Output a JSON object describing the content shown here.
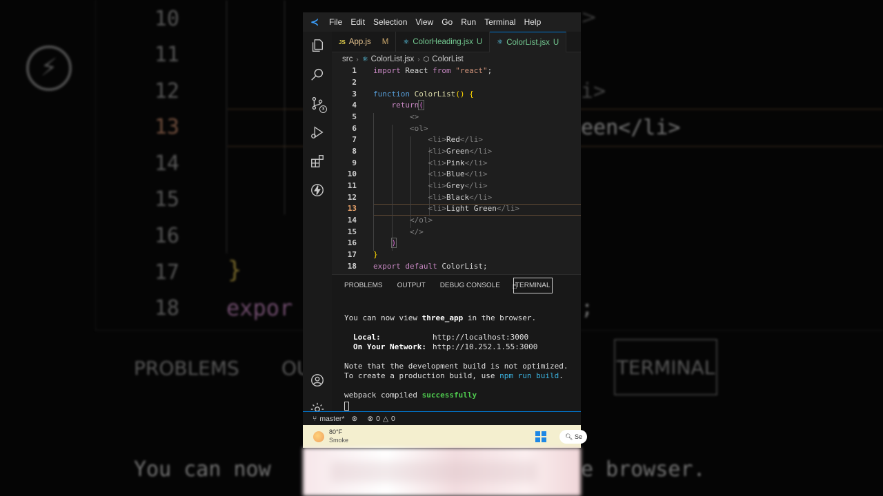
{
  "menubar": {
    "items": [
      "File",
      "Edit",
      "Selection",
      "View",
      "Go",
      "Run",
      "Terminal",
      "Help"
    ]
  },
  "tabs": [
    {
      "icon": "JS",
      "name": "App.js",
      "status": "M"
    },
    {
      "icon": "⚛",
      "name": "ColorHeading.jsx",
      "status": "U"
    },
    {
      "icon": "⚛",
      "name": "ColorList.jsx",
      "status": "U"
    }
  ],
  "breadcrumb": {
    "folder": "src",
    "file": "ColorList.jsx",
    "symbol": "ColorList"
  },
  "editor": {
    "line_numbers": [
      "1",
      "2",
      "3",
      "4",
      "5",
      "6",
      "7",
      "8",
      "9",
      "10",
      "11",
      "12",
      "13",
      "14",
      "15",
      "16",
      "17",
      "18"
    ],
    "current_line": "13",
    "l1": {
      "import": "import",
      "name": "React",
      "from": "from",
      "module": "\"react\"",
      "semi": ";"
    },
    "l3": {
      "function": "function",
      "name": "ColorList",
      "parens": "()",
      "brace": "{"
    },
    "l4": {
      "return": "return",
      "paren": "("
    },
    "l5": "<>",
    "l6": "<ol>",
    "items": [
      "Red",
      "Green",
      "Pink",
      "Blue",
      "Grey",
      "Black",
      "Light Green"
    ],
    "li_open": "<li>",
    "li_close": "</li>",
    "l14": "</ol>",
    "l15": "</>",
    "l16": ")",
    "l17": "}",
    "l18": {
      "export": "export",
      "default": "default",
      "name": "ColorList",
      "semi": ";"
    }
  },
  "panel": {
    "tabs": [
      "PROBLEMS",
      "OUTPUT",
      "DEBUG CONSOLE",
      "TERMINAL"
    ],
    "active_tab": "TERMINAL",
    "terminal": {
      "view_pre": "You can now view ",
      "app_name": "three_app",
      "view_post": " in the browser.",
      "local_label": "Local:",
      "local_url": "http://localhost:3000",
      "network_label": "On Your Network:",
      "network_url": "http://10.252.1.55:3000",
      "note1": "Note that the development build is not optimized.",
      "note2_pre": "To create a production build, use ",
      "note2_cmd": "npm run build",
      "note2_post": ".",
      "compiled_pre": "webpack compiled ",
      "compiled_status": "successfully"
    }
  },
  "statusbar": {
    "branch": "master*",
    "errors": "0",
    "warnings": "0"
  },
  "taskbar": {
    "temperature": "80°F",
    "condition": "Smoke",
    "search": "Se"
  },
  "background": {
    "line_numbers": [
      "10",
      "11",
      "12",
      "13",
      "14",
      "15",
      "16",
      "17",
      "18"
    ],
    "right_a": "i>",
    "right_b": "een</li>",
    "brace": "}",
    "export": "expor",
    "right_c": ";",
    "problems": "PROBLEMS",
    "ou": "OU",
    "terminal": "TERMINAL",
    "can_now": "You can now",
    "browser": "e browser."
  },
  "colors": {
    "accent": "#0078d4",
    "keyword": "#c586c0",
    "function": "#dcdcaa",
    "string": "#ce9178",
    "success": "#4ec94e"
  }
}
